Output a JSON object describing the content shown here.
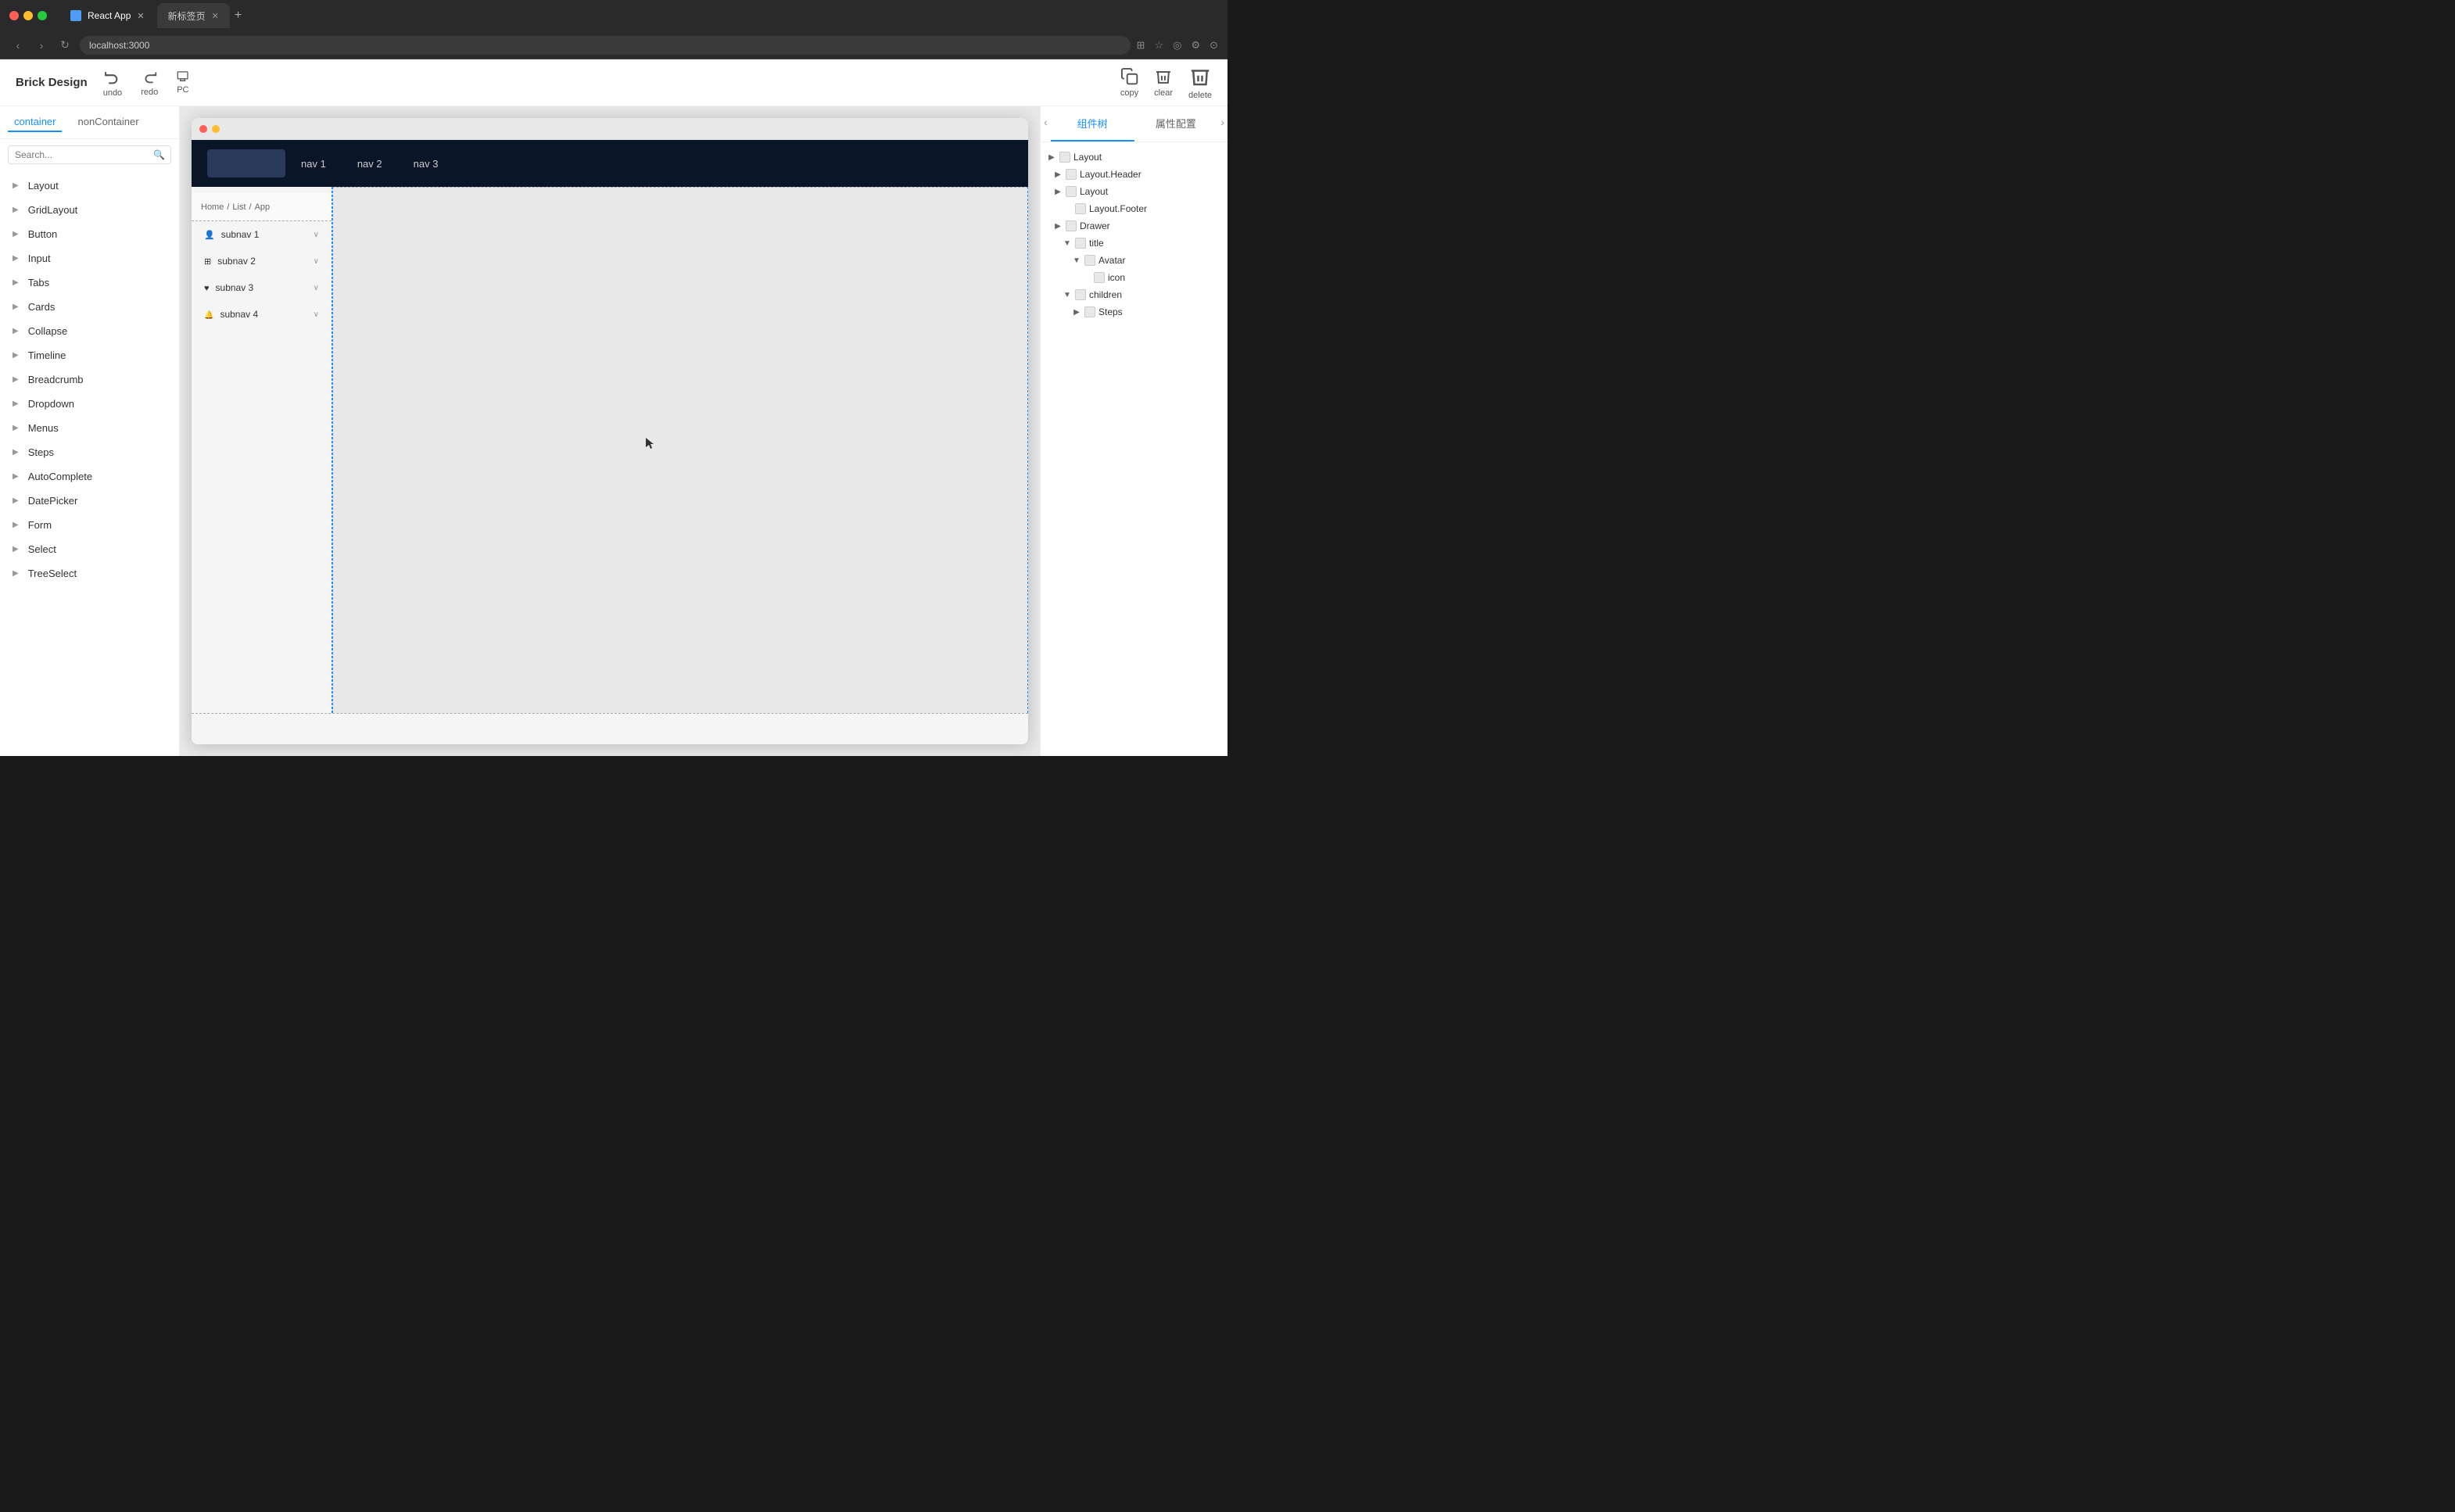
{
  "browser": {
    "tab1_label": "React App",
    "tab2_label": "新标签页",
    "address": "localhost:3000",
    "favicon_alt": "React"
  },
  "toolbar": {
    "brand": "Brick Design",
    "undo_label": "undo",
    "redo_label": "redo",
    "pc_label": "PC",
    "copy_label": "copy",
    "clear_label": "clear",
    "delete_label": "delete"
  },
  "left_panel": {
    "tab_container": "container",
    "tab_non_container": "nonContainer",
    "search_placeholder": "Search...",
    "components": [
      "Layout",
      "GridLayout",
      "Button",
      "Input",
      "Tabs",
      "Cards",
      "Collapse",
      "Timeline",
      "Breadcrumb",
      "Dropdown",
      "Menus",
      "Steps",
      "AutoComplete",
      "DatePicker",
      "Form",
      "Select",
      "TreeSelect"
    ]
  },
  "preview": {
    "nav_links": [
      "nav 1",
      "nav 2",
      "nav 3"
    ],
    "subnavs": [
      {
        "label": "subnav 1",
        "icon": "user"
      },
      {
        "label": "subnav 2",
        "icon": "grid"
      },
      {
        "label": "subnav 3",
        "icon": "heart"
      },
      {
        "label": "subnav 4",
        "icon": "bell"
      }
    ],
    "breadcrumb": [
      "Home",
      "List",
      "App"
    ]
  },
  "right_panel": {
    "tab_tree": "组件树",
    "tab_props": "属性配置",
    "tree": [
      {
        "label": "Layout",
        "level": 0,
        "expanded": true,
        "has_children": true
      },
      {
        "label": "Layout.Header",
        "level": 1,
        "expanded": false,
        "has_children": true
      },
      {
        "label": "Layout",
        "level": 1,
        "expanded": false,
        "has_children": true
      },
      {
        "label": "Layout.Footer",
        "level": 2,
        "expanded": false,
        "has_children": false
      },
      {
        "label": "Drawer",
        "level": 1,
        "expanded": true,
        "has_children": true
      },
      {
        "label": "title",
        "level": 2,
        "expanded": true,
        "has_children": true
      },
      {
        "label": "Avatar",
        "level": 3,
        "expanded": true,
        "has_children": true
      },
      {
        "label": "icon",
        "level": 4,
        "expanded": false,
        "has_children": false
      },
      {
        "label": "children",
        "level": 2,
        "expanded": true,
        "has_children": true
      },
      {
        "label": "Steps",
        "level": 3,
        "expanded": false,
        "has_children": false
      }
    ]
  },
  "colors": {
    "accent": "#1890ff",
    "nav_bg": "#0a1628",
    "sidebar_bg": "#f5f5f5"
  }
}
